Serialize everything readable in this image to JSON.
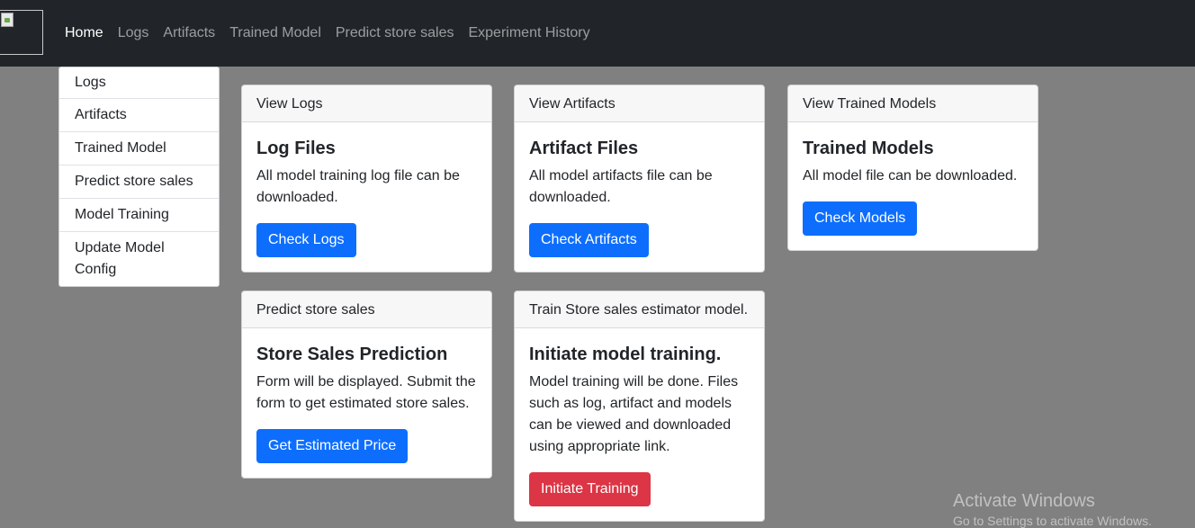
{
  "navbar": {
    "links": [
      {
        "label": "Home",
        "active": true
      },
      {
        "label": "Logs"
      },
      {
        "label": "Artifacts"
      },
      {
        "label": "Trained Model"
      },
      {
        "label": "Predict store sales"
      },
      {
        "label": "Experiment History"
      }
    ]
  },
  "dropdown": {
    "items": [
      "Logs",
      "Artifacts",
      "Trained Model",
      "Predict store sales",
      "Model Training",
      "Update Model Config"
    ]
  },
  "cards": {
    "logs": {
      "header": "View Logs",
      "title": "Log Files",
      "text": "All model training log file can be downloaded.",
      "button": "Check Logs"
    },
    "artifacts": {
      "header": "View Artifacts",
      "title": "Artifact Files",
      "text": "All model artifacts file can be downloaded.",
      "button": "Check Artifacts"
    },
    "models": {
      "header": "View Trained Models",
      "title": "Trained Models",
      "text": "All model file can be downloaded.",
      "button": "Check Models"
    },
    "predict": {
      "header": "Predict store sales",
      "title": "Store Sales Prediction",
      "text": "Form will be displayed. Submit the form to get estimated store sales.",
      "button": "Get Estimated Price"
    },
    "train": {
      "header": "Train Store sales estimator model.",
      "title": "Initiate model training.",
      "text": "Model training will be done. Files such as log, artifact and models can be viewed and downloaded using appropriate link.",
      "button": "Initiate Training"
    }
  },
  "watermark": {
    "title": "Activate Windows",
    "subtitle": "Go to Settings to activate Windows."
  },
  "colors": {
    "navbar": "#212529",
    "page_background": "#808080",
    "primary_button": "#0d6efd",
    "danger_button": "#dc3545"
  }
}
